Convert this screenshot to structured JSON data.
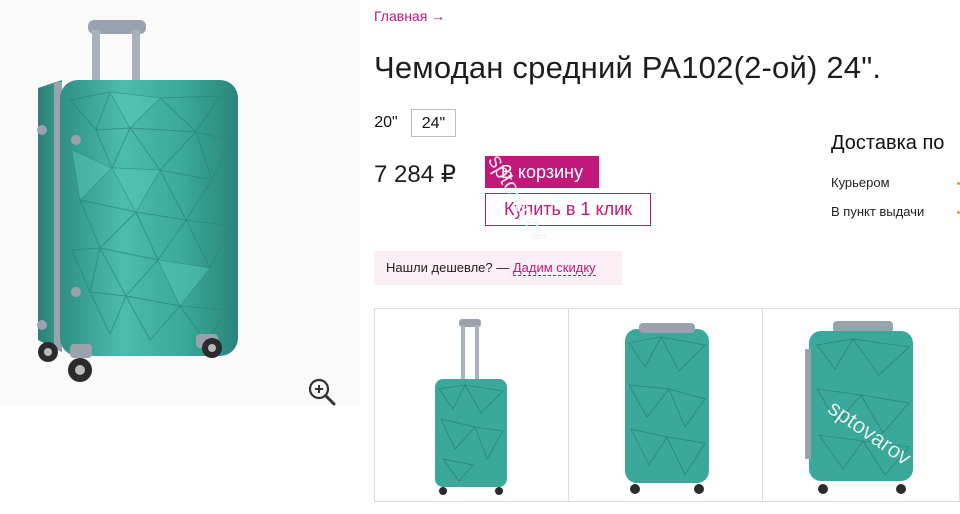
{
  "breadcrumb": {
    "label": "Главная →"
  },
  "product": {
    "title": "Чемодан средний PA102(2-ой) 24\".",
    "price": "7 284 ₽"
  },
  "sizes": [
    {
      "label": "20\"",
      "selected": false
    },
    {
      "label": "24\"",
      "selected": true
    }
  ],
  "actions": {
    "cart_label": "В корзину",
    "oneclick_label": "Купить в 1 клик"
  },
  "delivery": {
    "title": "Доставка по",
    "courier": "Курьером",
    "pickup": "В пункт выдачи"
  },
  "cheaper": {
    "prefix": "Нашли дешевле? — ",
    "link": "Дадим скидку"
  },
  "gallery": {
    "zoom_icon": "zoom-in-icon",
    "thumbnails": [
      "suitcase-front-handle-up",
      "suitcase-front",
      "suitcase-side"
    ]
  },
  "watermark": "sptovarov",
  "colors": {
    "accent": "#c2187a",
    "suitcase": "#3aa89a",
    "cheaper_bg": "#fbeef4"
  }
}
